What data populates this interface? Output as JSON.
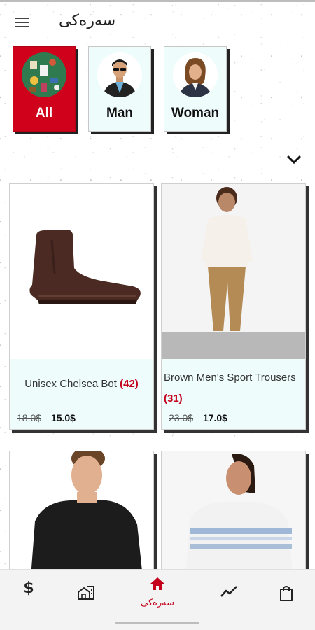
{
  "header": {
    "title": "سەرەکی"
  },
  "categories": [
    {
      "label": "All",
      "active": true
    },
    {
      "label": "Man",
      "active": false
    },
    {
      "label": "Woman",
      "active": false
    }
  ],
  "products": [
    {
      "name": "Unisex Chelsea Bot",
      "count": "(42)",
      "old_price": "18.0$",
      "price": "15.0$"
    },
    {
      "name": "Brown Men's Sport Trousers",
      "count": "(31)",
      "old_price": "23.0$",
      "price": "17.0$"
    }
  ],
  "bottom_nav": {
    "items": [
      {
        "icon": "dollar-icon",
        "label": ""
      },
      {
        "icon": "stores-icon",
        "label": ""
      },
      {
        "icon": "home-icon",
        "label": "سەرەکی",
        "active": true
      },
      {
        "icon": "trend-icon",
        "label": ""
      },
      {
        "icon": "shopping-bag-icon",
        "label": ""
      }
    ],
    "dollar_symbol": "$"
  },
  "colors": {
    "accent": "#c4001a",
    "card_bg": "#eefcfc",
    "active_category": "#d0011b"
  }
}
